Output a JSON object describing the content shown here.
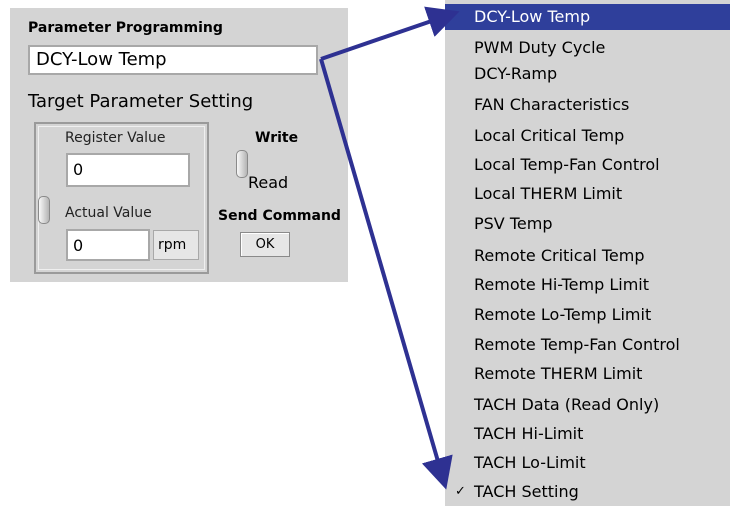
{
  "panel": {
    "title": "Parameter Programming",
    "parameter_value": "DCY-Low Temp",
    "section_title": "Target Parameter Setting",
    "register_label": "Register Value",
    "register_value": "0",
    "actual_label": "Actual Value",
    "actual_value": "0",
    "actual_unit": "rpm",
    "write_label": "Write",
    "read_label": "Read",
    "send_command_label": "Send Command",
    "ok_label": "OK"
  },
  "menu": {
    "items": [
      "DCY-Low Temp",
      "PWM Duty Cycle",
      "DCY-Ramp",
      "FAN Characteristics",
      "Local Critical Temp",
      "Local Temp-Fan Control",
      "Local THERM Limit",
      "PSV Temp",
      "Remote Critical Temp",
      "Remote Hi-Temp Limit",
      "Remote Lo-Temp Limit",
      "Remote Temp-Fan Control",
      "Remote THERM Limit",
      "TACH Data (Read Only)",
      "TACH Hi-Limit",
      "TACH Lo-Limit",
      "TACH Setting"
    ],
    "highlighted_item": "DCY-Low Temp",
    "checked_item": "TACH Setting",
    "check_mark": "✓"
  },
  "colors": {
    "highlight": "#2f3f9b",
    "arrow": "#2e3192",
    "panel_bg": "#d4d4d4"
  }
}
